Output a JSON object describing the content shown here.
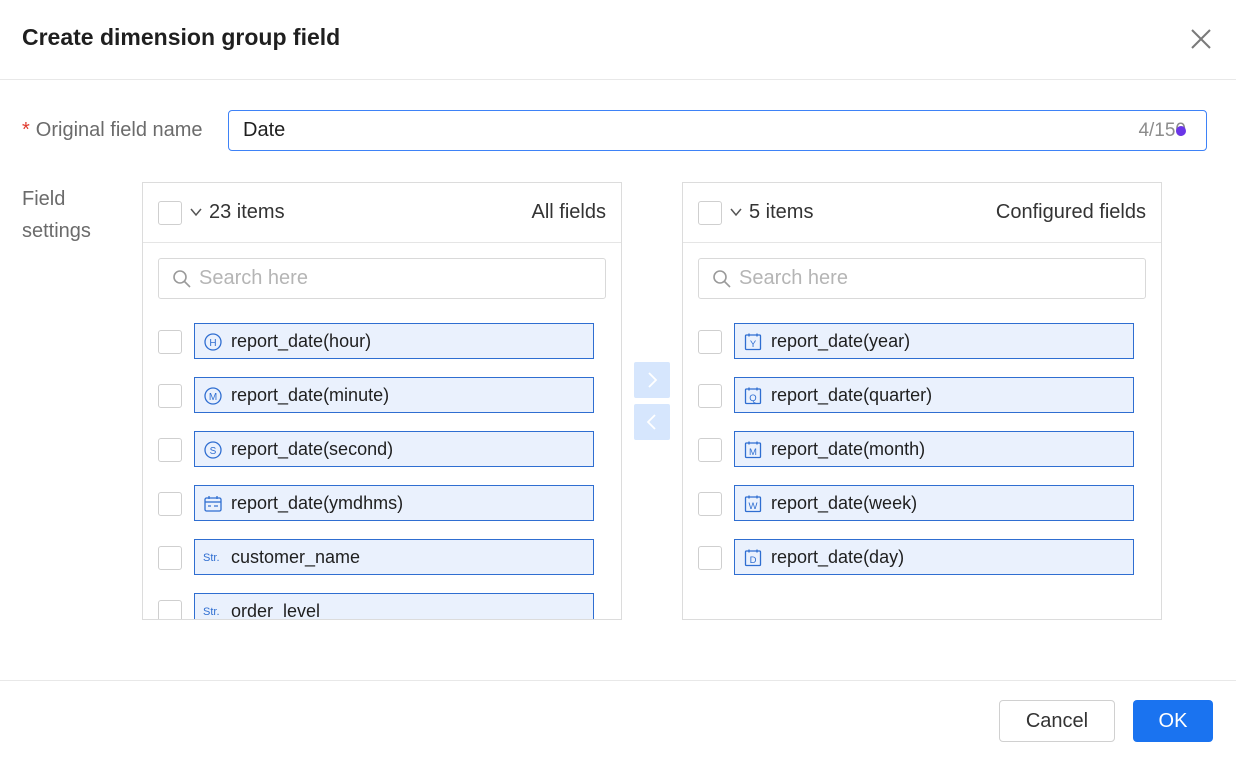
{
  "dialog": {
    "title": "Create dimension group field",
    "close_icon": "close-icon"
  },
  "form": {
    "required_mark": "*",
    "original_field_label": "Original field name",
    "original_field_value": "Date",
    "char_count": "4/150",
    "field_settings_label_line1": "Field",
    "field_settings_label_line2": "settings"
  },
  "left_panel": {
    "item_count": "23 items",
    "title": "All fields",
    "search_placeholder": "Search here",
    "items": [
      {
        "label": "report_date(hour)",
        "icon": "hour-icon",
        "glyph": "H"
      },
      {
        "label": "report_date(minute)",
        "icon": "minute-icon",
        "glyph": "M"
      },
      {
        "label": "report_date(second)",
        "icon": "second-icon",
        "glyph": "S"
      },
      {
        "label": "report_date(ymdhms)",
        "icon": "calendar-icon",
        "glyph": ""
      },
      {
        "label": "customer_name",
        "icon": "string-type-icon",
        "glyph": "Str."
      },
      {
        "label": "order_level",
        "icon": "string-type-icon",
        "glyph": "Str."
      }
    ]
  },
  "right_panel": {
    "item_count": "5 items",
    "title": "Configured fields",
    "search_placeholder": "Search here",
    "items": [
      {
        "label": "report_date(year)",
        "icon": "year-icon",
        "glyph": "Y"
      },
      {
        "label": "report_date(quarter)",
        "icon": "quarter-icon",
        "glyph": "Q"
      },
      {
        "label": "report_date(month)",
        "icon": "month-icon",
        "glyph": "M"
      },
      {
        "label": "report_date(week)",
        "icon": "week-icon",
        "glyph": "W"
      },
      {
        "label": "report_date(day)",
        "icon": "day-icon",
        "glyph": "D"
      }
    ]
  },
  "footer": {
    "cancel_label": "Cancel",
    "ok_label": "OK"
  },
  "colors": {
    "primary": "#1a73f0",
    "chip_background": "#eaf1fd",
    "chip_border": "#2f6ed1",
    "required": "#e0392d",
    "transfer_button": "#d6e6fd"
  }
}
